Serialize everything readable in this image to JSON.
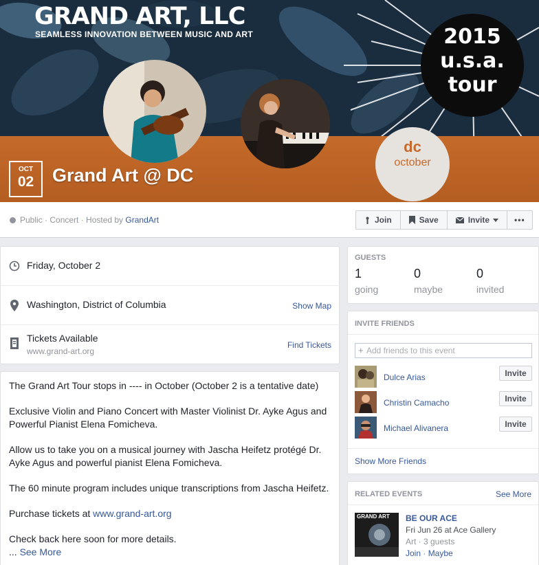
{
  "cover": {
    "brand": "GRAND ART, LLC",
    "brand_tagline": "SEAMLESS INNOVATION BETWEEN MUSIC AND ART",
    "tour_line1": "2015",
    "tour_line2": "u.s.a.",
    "tour_line3": "tour",
    "badge_line1": "dc",
    "badge_line2": "october"
  },
  "event": {
    "month": "OCT",
    "day": "02",
    "title": "Grand Art @ DC",
    "meta_prefix": "Public · Concert · Hosted by ",
    "host": "GrandArt"
  },
  "actions": {
    "join": "Join",
    "save": "Save",
    "invite": "Invite",
    "more": "•••"
  },
  "details": {
    "date": "Friday, October 2",
    "location": "Washington, District of Columbia",
    "show_map": "Show Map",
    "tickets": "Tickets Available",
    "tickets_url": "www.grand-art.org",
    "find_tickets": "Find Tickets"
  },
  "description": {
    "p1": "The Grand Art Tour stops in ---- in October (October 2 is a tentative date)",
    "p2": "Exclusive Violin and Piano Concert with Master Violinist Dr. Ayke Agus and Powerful Pianist Elena Fomicheva.",
    "p3": "Allow us to take you on a musical journey with Jascha Heifetz protégé Dr. Ayke Agus and powerful pianist Elena Fomicheva.",
    "p4": "The 60 minute program includes unique transcriptions from Jascha Heifetz.",
    "p5_prefix": "Purchase tickets at ",
    "p5_link": "www.grand-art.org",
    "p6": "Check back here soon for more details.",
    "ellipsis": "... ",
    "see_more": "See More"
  },
  "guests": {
    "heading": "GUESTS",
    "stats": [
      {
        "value": "1",
        "label": "going"
      },
      {
        "value": "0",
        "label": "maybe"
      },
      {
        "value": "0",
        "label": "invited"
      }
    ]
  },
  "invite_friends": {
    "heading": "INVITE FRIENDS",
    "placeholder": "Add friends to this event",
    "friends": [
      {
        "name": "Dulce Arias",
        "button": "Invite"
      },
      {
        "name": "Christin Camacho",
        "button": "Invite"
      },
      {
        "name": "Michael Alivanera",
        "button": "Invite"
      }
    ],
    "show_more": "Show More Friends"
  },
  "related": {
    "heading": "RELATED EVENTS",
    "see_more": "See More",
    "event": {
      "thumb_text": "GRAND ART",
      "title": "BE OUR ACE",
      "when": "Fri Jun 26 at Ace Gallery",
      "meta": "Art · 3 guests",
      "join": "Join",
      "maybe": "Maybe",
      "sep": " · "
    }
  }
}
